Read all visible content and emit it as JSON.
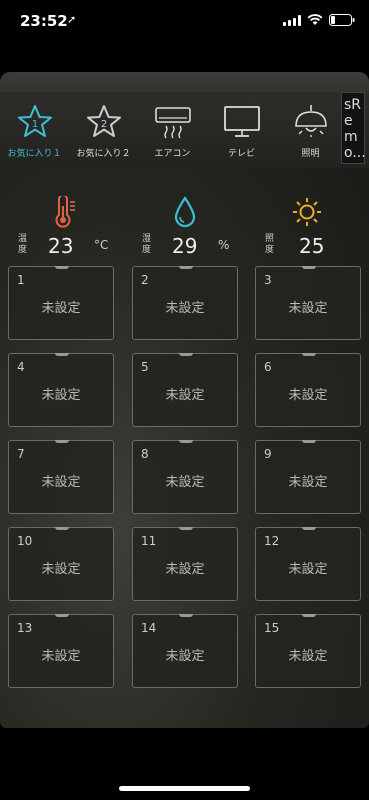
{
  "status": {
    "time": "23:52",
    "location_icon": "location-arrow-icon"
  },
  "favorites": [
    {
      "label": "お気に入り１",
      "icon": "star-1-icon",
      "number": "1",
      "active": true
    },
    {
      "label": "お気に入り２",
      "icon": "star-2-icon",
      "number": "2",
      "active": false
    },
    {
      "label": "エアコン",
      "icon": "air-conditioner-icon"
    },
    {
      "label": "テレビ",
      "icon": "tv-icon"
    },
    {
      "label": "照明",
      "icon": "ceiling-light-icon"
    }
  ],
  "more_app": {
    "label": "sRemo..."
  },
  "sensors": {
    "temperature": {
      "label": "温度",
      "value": "23",
      "unit": "°C",
      "color": "#e26248"
    },
    "humidity": {
      "label": "湿度",
      "value": "29",
      "unit": "%",
      "color": "#3dbfd6"
    },
    "illuminance": {
      "label": "照度",
      "value": "25",
      "color": "#e8b02a"
    }
  },
  "buttons": [
    {
      "num": "1",
      "label": "未設定"
    },
    {
      "num": "2",
      "label": "未設定"
    },
    {
      "num": "3",
      "label": "未設定"
    },
    {
      "num": "4",
      "label": "未設定"
    },
    {
      "num": "5",
      "label": "未設定"
    },
    {
      "num": "6",
      "label": "未設定"
    },
    {
      "num": "7",
      "label": "未設定"
    },
    {
      "num": "8",
      "label": "未設定"
    },
    {
      "num": "9",
      "label": "未設定"
    },
    {
      "num": "10",
      "label": "未設定"
    },
    {
      "num": "11",
      "label": "未設定"
    },
    {
      "num": "12",
      "label": "未設定"
    },
    {
      "num": "13",
      "label": "未設定"
    },
    {
      "num": "14",
      "label": "未設定"
    },
    {
      "num": "15",
      "label": "未設定"
    }
  ]
}
